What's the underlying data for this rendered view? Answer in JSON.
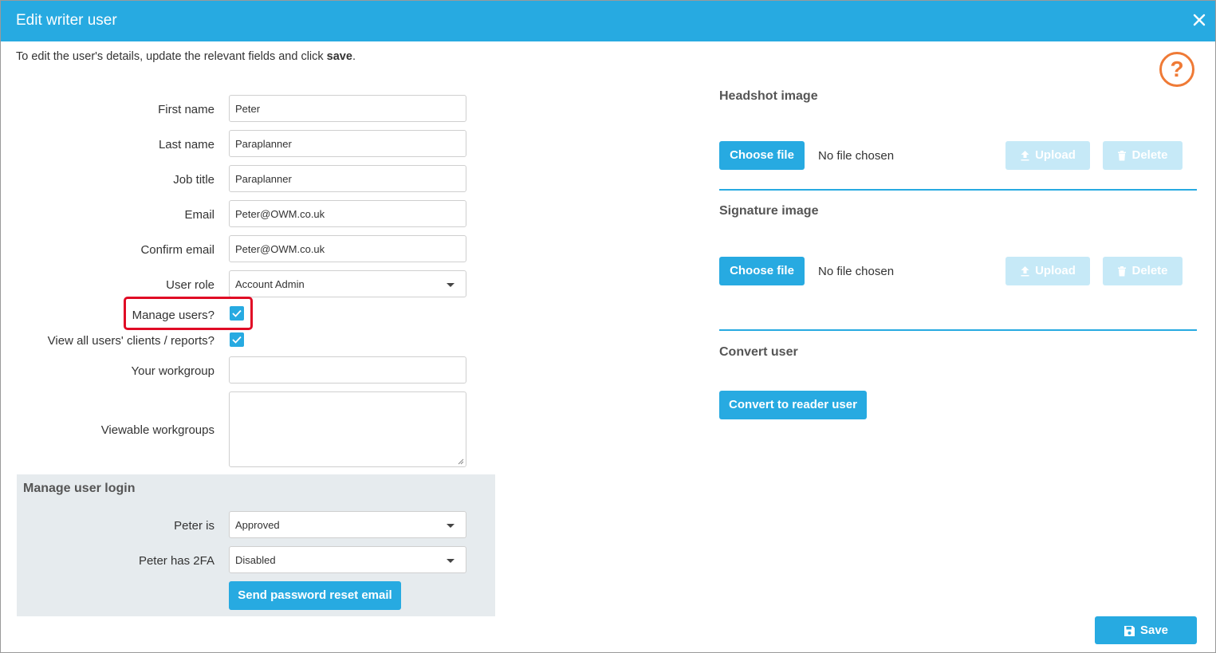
{
  "dialog": {
    "title": "Edit writer user"
  },
  "intro": {
    "prefix": "To edit the user's details, update the relevant fields and click ",
    "bold": "save",
    "suffix": "."
  },
  "help": {
    "glyph": "?"
  },
  "fields": {
    "first_name": {
      "label": "First name",
      "value": "Peter"
    },
    "last_name": {
      "label": "Last name",
      "value": "Paraplanner"
    },
    "job_title": {
      "label": "Job title",
      "value": "Paraplanner"
    },
    "email": {
      "label": "Email",
      "value": "Peter@OWM.co.uk"
    },
    "confirm_email": {
      "label": "Confirm email",
      "value": "Peter@OWM.co.uk"
    },
    "user_role": {
      "label": "User role",
      "value": "Account Admin"
    },
    "manage_users": {
      "label": "Manage users?",
      "checked": true
    },
    "view_all": {
      "label": "View all users' clients / reports?",
      "checked": true
    },
    "your_workgroup": {
      "label": "Your workgroup",
      "value": ""
    },
    "viewable_workgroups": {
      "label": "Viewable workgroups",
      "value": ""
    }
  },
  "login": {
    "title": "Manage user login",
    "status": {
      "label": "Peter is",
      "value": "Approved"
    },
    "twofa": {
      "label": "Peter has 2FA",
      "value": "Disabled"
    },
    "reset_button": "Send password reset email"
  },
  "headshot": {
    "title": "Headshot image",
    "choose": "Choose file",
    "nofile": "No file chosen",
    "upload": "Upload",
    "delete": "Delete"
  },
  "signature": {
    "title": "Signature image",
    "choose": "Choose file",
    "nofile": "No file chosen",
    "upload": "Upload",
    "delete": "Delete"
  },
  "convert": {
    "title": "Convert user",
    "button": "Convert to reader user"
  },
  "save_button": "Save",
  "colors": {
    "accent": "#27aae1",
    "help": "#ef7a36",
    "highlight": "#e00a25",
    "panel": "#e6ebee"
  }
}
